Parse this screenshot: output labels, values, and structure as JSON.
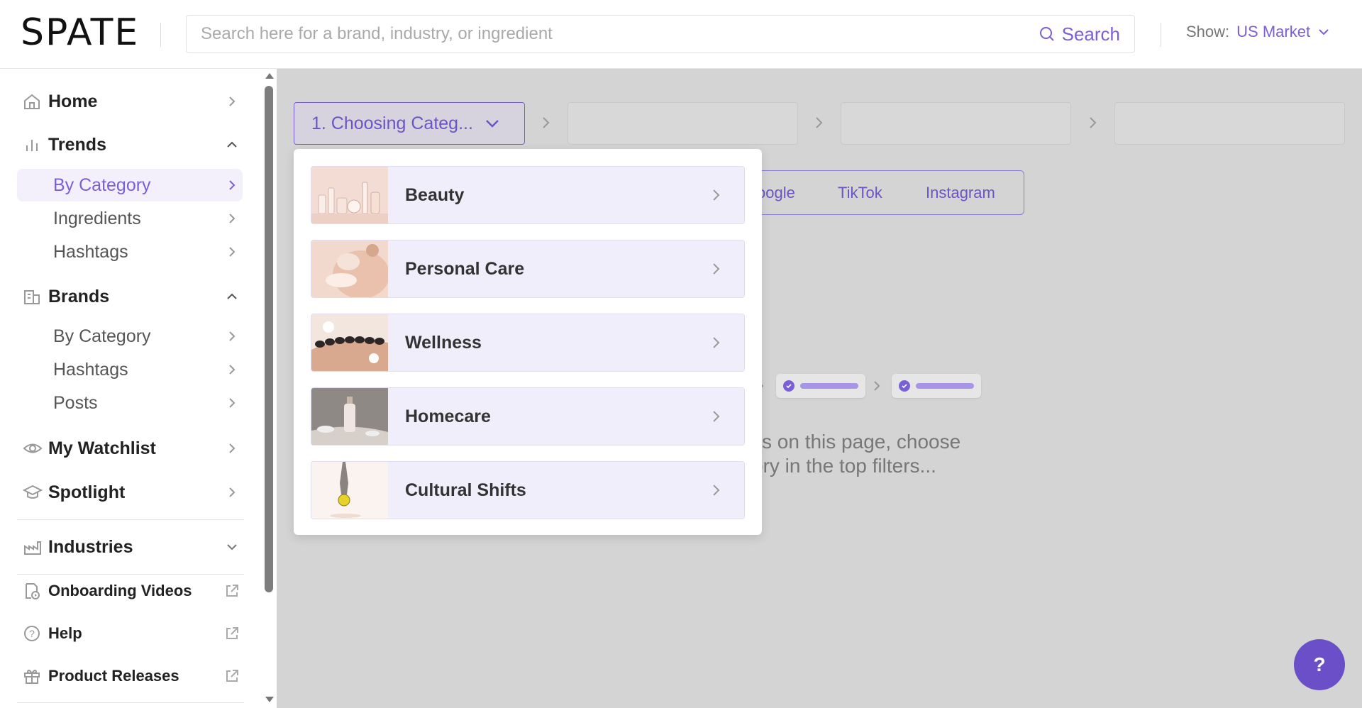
{
  "header": {
    "logo": "SPATE",
    "search_placeholder": "Search here for a brand, industry, or ingredient",
    "search_button": "Search",
    "show_label": "Show:",
    "show_value": "US Market"
  },
  "sidebar": {
    "home": "Home",
    "trends": {
      "label": "Trends",
      "items": [
        "By Category",
        "Ingredients",
        "Hashtags"
      ]
    },
    "brands": {
      "label": "Brands",
      "items": [
        "By Category",
        "Hashtags",
        "Posts"
      ]
    },
    "watchlist": "My Watchlist",
    "spotlight": "Spotlight",
    "industries": "Industries",
    "onboarding": "Onboarding Videos",
    "help": "Help",
    "releases": "Product Releases"
  },
  "main": {
    "step1_label": "1. Choosing Categ...",
    "platforms": [
      "oogle",
      "TikTok",
      "Instagram"
    ],
    "empty_line1": "lts on this page, choose",
    "empty_line2": "ory in the top filters..."
  },
  "dropdown": {
    "categories": [
      "Beauty",
      "Personal Care",
      "Wellness",
      "Homecare",
      "Cultural Shifts"
    ]
  },
  "help_fab": "?",
  "colors": {
    "accent": "#7b5fd6",
    "overlay": "#d4d4d4",
    "fab": "#6a4fc8"
  }
}
